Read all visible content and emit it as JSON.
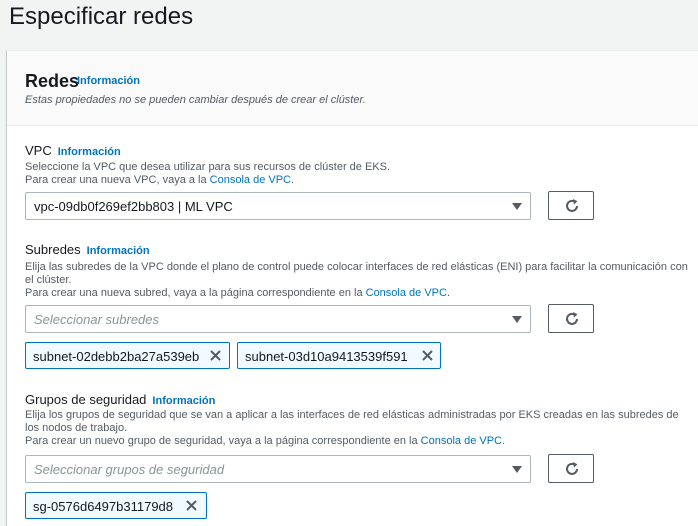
{
  "page": {
    "title": "Especificar redes"
  },
  "panel": {
    "title": "Redes",
    "info_label": "Información",
    "description": "Estas propiedades no se pueden cambiar después de crear el clúster."
  },
  "vpc": {
    "label": "VPC",
    "info_label": "Información",
    "desc_line1": "Seleccione la VPC que desea utilizar para sus recursos de clúster de EKS.",
    "desc_line2_prefix": "Para crear una nueva VPC, vaya a la ",
    "desc_link": "Consola de VPC",
    "desc_line2_suffix": ".",
    "selected_value": "vpc-09db0f269ef2bb803 | ML VPC",
    "dropdown_icon": "caret-down-icon",
    "refresh_icon": "refresh-icon"
  },
  "subnets": {
    "label": "Subredes",
    "info_label": "Información",
    "desc_line1": "Elija las subredes de la VPC donde el plano de control puede colocar interfaces de red elásticas (ENI) para facilitar la comunicación con el clúster.",
    "desc_line2_prefix": "Para crear una nueva subred, vaya a la página correspondiente en la ",
    "desc_link": "Consola de VPC",
    "desc_line2_suffix": ".",
    "placeholder": "Seleccionar subredes",
    "tokens": [
      "subnet-02debb2ba27a539eb",
      "subnet-03d10a9413539f591"
    ]
  },
  "security_groups": {
    "label": "Grupos de seguridad",
    "info_label": "Información",
    "desc_line1": "Elija los grupos de seguridad que se van a aplicar a las interfaces de red elásticas administradas por EKS creadas en las subredes de los nodos de trabajo.",
    "desc_line2_prefix": "Para crear un nuevo grupo de seguridad, vaya a la página correspondiente en la ",
    "desc_link": "Consola de VPC",
    "desc_line2_suffix": ".",
    "placeholder": "Seleccionar grupos de seguridad",
    "tokens": [
      "sg-0576d6497b31179d8"
    ]
  },
  "colors": {
    "link": "#0073bb",
    "token_border": "#0073bb",
    "token_bg": "#f1faff",
    "text": "#16191f",
    "secondary_text": "#545b64"
  }
}
